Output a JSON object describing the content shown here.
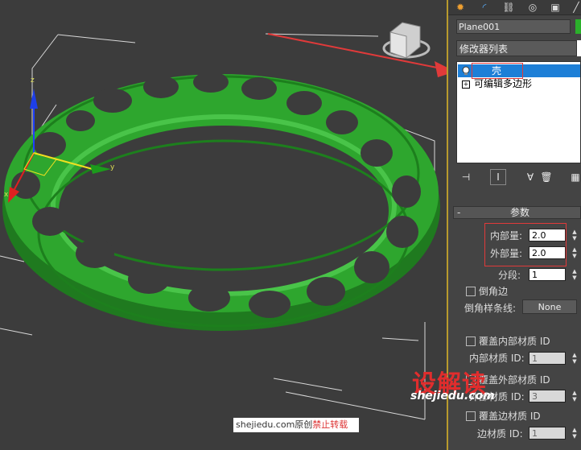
{
  "panel": {
    "object_name": "Plane001",
    "modifier_list": "修改器列表",
    "stack": [
      {
        "label": "壳",
        "selected": true
      },
      {
        "label": "可编辑多边形",
        "selected": false
      }
    ],
    "rollout_title": "参数",
    "inner_amount_label": "内部量:",
    "inner_amount_value": "2.0",
    "outer_amount_label": "外部量:",
    "outer_amount_value": "2.0",
    "segments_label": "分段:",
    "segments_value": "1",
    "bevel_edges_label": "倒角边",
    "bevel_spline_label": "倒角样条线:",
    "bevel_spline_value": "None",
    "override_inner_mat_label": "覆盖内部材质 ID",
    "inner_mat_id_label": "内部材质 ID:",
    "inner_mat_id_value": "1",
    "override_outer_mat_label": "覆盖外部材质 ID",
    "outer_mat_id_label": "外部材质 ID:",
    "outer_mat_id_value": "3",
    "override_edge_mat_label": "覆盖边材质 ID",
    "edge_mat_id_label": "边材质 ID:",
    "edge_mat_id_value": "1"
  },
  "viewport": {
    "axis_x": "x",
    "axis_y": "y",
    "axis_z": "z",
    "object_color": "#2ea62e"
  },
  "watermark": {
    "logo": "设解读",
    "site": "shejiedu.com",
    "credit_prefix": "shejiedu.com原创",
    "credit_warning": "禁止转载"
  }
}
